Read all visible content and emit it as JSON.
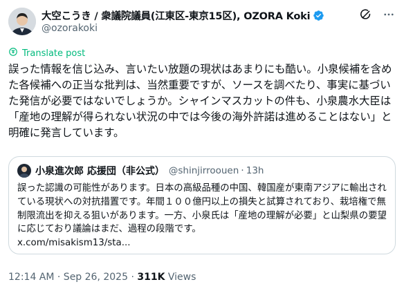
{
  "author": {
    "display_name": "大空こうき / 衆議院議員(江東区-東京15区), OZORA Koki",
    "handle": "@ozorakoki"
  },
  "icons": {
    "verified": "verified-badge-icon",
    "grok": "grok-icon",
    "more": "more-options-icon",
    "translate": "translate-icon"
  },
  "colors": {
    "verified": "#1d9bf0",
    "translate": "#00ba7c",
    "muted": "#536471"
  },
  "translate_label": "Translate post",
  "post_text": "誤った情報を信じ込み、言いたい放題の現状はあまりにも酷い。小泉候補を含めた各候補への正当な批判は、当然重要ですが、ソースを調べたり、事実に基づいた発信が必要ではないでしょうか。シャインマスカットの件も、小泉農水大臣は「産地の理解が得られない状況の中では今後の海外許諾は進めることはない」と明確に発言しています。",
  "quote": {
    "display_name": "小泉進次郎 応援団（非公式）",
    "handle": "@shinjirroouen",
    "separator": "·",
    "time": "13h",
    "text": "誤った認識の可能性があります。日本の高級品種の中国、韓国産が東南アジアに輸出されている現状への対抗措置です。年間１００億円以上の損失と試算されており、栽培権で無制限流出を抑える狙いがあります。一方、小泉氏は「産地の理解が必要」と山梨県の要望に応じており議論はまだ、過程の段階です。",
    "link": "x.com/misakism13/sta..."
  },
  "meta": {
    "timestamp": "12:14 AM · Sep 26, 2025",
    "separator": "·",
    "views_count": "311K",
    "views_label": "Views"
  }
}
